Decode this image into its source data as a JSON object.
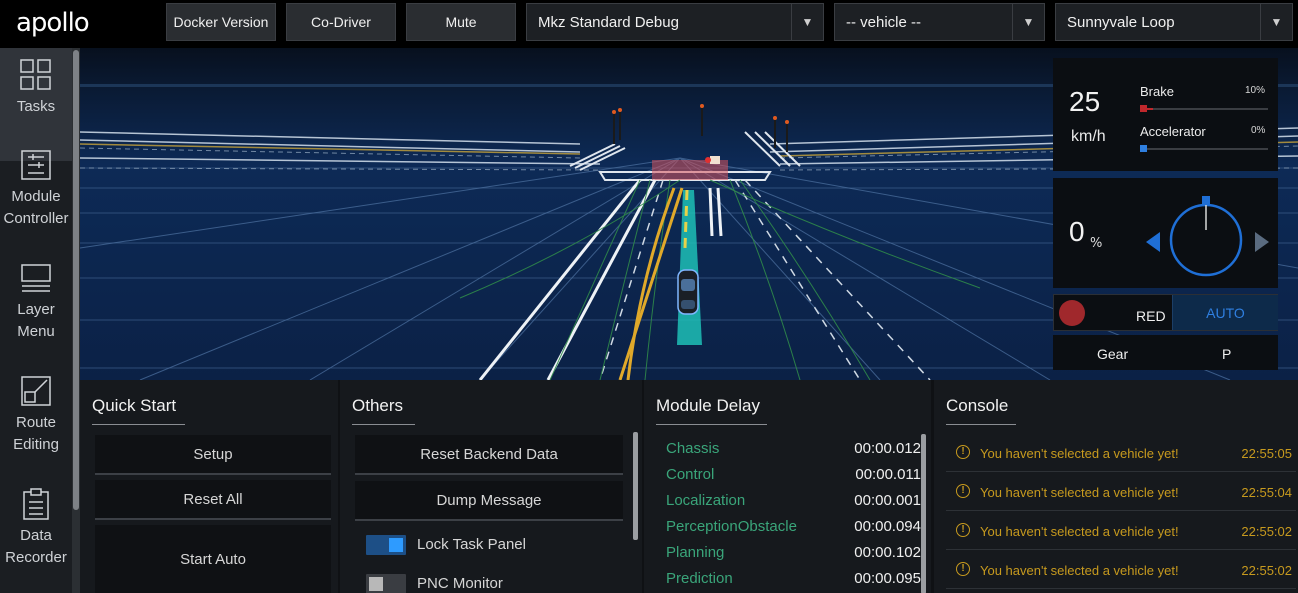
{
  "header": {
    "logo": "apollo",
    "docker_button": "Docker Version",
    "codriver_button": "Co-Driver",
    "mute_button": "Mute",
    "mode_select": "Mkz Standard Debug",
    "vehicle_select": "-- vehicle --",
    "map_select": "Sunnyvale Loop"
  },
  "sidebar": {
    "items": [
      {
        "label": "Tasks",
        "icon": "grid-icon"
      },
      {
        "label": "Module Controller",
        "icon": "sliders-icon"
      },
      {
        "label": "Layer Menu",
        "icon": "layers-icon"
      },
      {
        "label": "Route Editing",
        "icon": "route-icon"
      },
      {
        "label": "Data Recorder",
        "icon": "clipboard-icon"
      }
    ]
  },
  "dashboard": {
    "speed": "25",
    "speed_unit": "km/h",
    "brake_label": "Brake",
    "brake_pct": "10%",
    "brake_level": 0.1,
    "accel_label": "Accelerator",
    "accel_pct": "0%",
    "accel_level": 0.0,
    "steering_value": "0",
    "steering_unit": "%",
    "signal_text": "RED",
    "driving_mode": "AUTO",
    "gear_label": "Gear",
    "gear_value": "P",
    "colors": {
      "signal_red": "#a0282c",
      "accent_blue": "#2f7fe0",
      "brake_red": "#c0282c"
    }
  },
  "quick_start": {
    "title": "Quick Start",
    "buttons": [
      "Setup",
      "Reset All",
      "Start Auto"
    ]
  },
  "others": {
    "title": "Others",
    "buttons": [
      "Reset Backend Data",
      "Dump Message"
    ],
    "toggles": [
      {
        "label": "Lock Task Panel",
        "on": true
      },
      {
        "label": "PNC Monitor",
        "on": false
      }
    ]
  },
  "module_delay": {
    "title": "Module Delay",
    "rows": [
      {
        "name": "Chassis",
        "time": "00:00.012"
      },
      {
        "name": "Control",
        "time": "00:00.011"
      },
      {
        "name": "Localization",
        "time": "00:00.001"
      },
      {
        "name": "PerceptionObstacle",
        "time": "00:00.094"
      },
      {
        "name": "Planning",
        "time": "00:00.102"
      },
      {
        "name": "Prediction",
        "time": "00:00.095"
      }
    ]
  },
  "console": {
    "title": "Console",
    "messages": [
      {
        "text": "You haven't selected a vehicle yet!",
        "time": "22:55:05"
      },
      {
        "text": "You haven't selected a vehicle yet!",
        "time": "22:55:04"
      },
      {
        "text": "You haven't selected a vehicle yet!",
        "time": "22:55:02"
      },
      {
        "text": "You haven't selected a vehicle yet!",
        "time": "22:55:02"
      }
    ]
  }
}
